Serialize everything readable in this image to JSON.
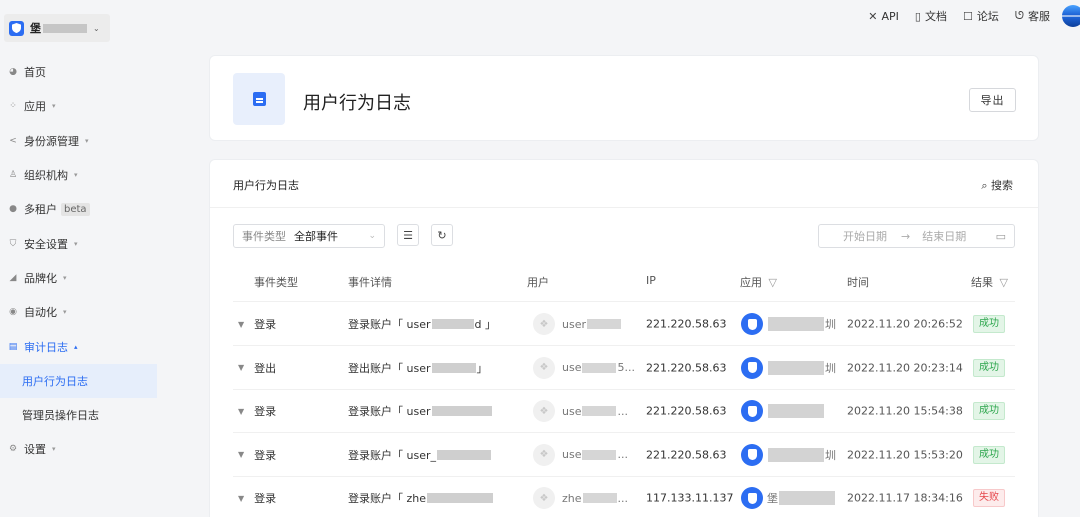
{
  "sidebar": {
    "brand_name": "堡",
    "items": [
      {
        "label": "首页",
        "icon": "pie-icon",
        "glyph": "◕",
        "caret": ""
      },
      {
        "label": "应用",
        "icon": "grid-icon",
        "glyph": "⁘",
        "caret": "▾"
      },
      {
        "label": "身份源管理",
        "icon": "share-icon",
        "glyph": "<",
        "caret": "▾"
      },
      {
        "label": "组织机构",
        "icon": "org-icon",
        "glyph": "♙",
        "caret": "▾"
      },
      {
        "label": "多租户",
        "icon": "tenant-icon",
        "glyph": "●",
        "caret": "",
        "badge": "beta"
      },
      {
        "label": "安全设置",
        "icon": "shield-icon",
        "glyph": "⛉",
        "caret": "▾"
      },
      {
        "label": "品牌化",
        "icon": "brand-icon",
        "glyph": "◢",
        "caret": "▾"
      },
      {
        "label": "自动化",
        "icon": "auto-icon",
        "glyph": "◉",
        "caret": "▾"
      },
      {
        "label": "审计日志",
        "icon": "audit-icon",
        "glyph": "▤",
        "caret": "▴"
      }
    ],
    "sub_items": [
      {
        "label": "用户行为日志"
      },
      {
        "label": "管理员操作日志"
      }
    ],
    "settings": {
      "label": "设置",
      "glyph": "⚙",
      "caret": "▾"
    }
  },
  "topbar": {
    "api": "API",
    "docs": "文档",
    "forum": "论坛",
    "support": "客服"
  },
  "header": {
    "title": "用户行为日志",
    "export_label": "导出"
  },
  "main": {
    "title": "用户行为日志",
    "search_label": "搜索",
    "filter_label": "事件类型",
    "filter_value": "全部事件",
    "date_start": "开始日期",
    "date_sep": "→",
    "date_end": "结束日期"
  },
  "table": {
    "columns": {
      "event_type": "事件类型",
      "detail": "事件详情",
      "user": "用户",
      "ip": "IP",
      "app": "应用",
      "time": "时间",
      "result": "结果"
    },
    "rows": [
      {
        "event": "登录",
        "detail_prefix": "登录账户「 user",
        "detail_suffix": "d 」",
        "user": "user",
        "ip": "221.220.58.63",
        "app_suffix": "圳",
        "time": "2022.11.20 20:26:52",
        "result": "成功",
        "ok": true
      },
      {
        "event": "登出",
        "detail_prefix": "登出账户「 user",
        "detail_suffix": "」",
        "user": "use",
        "user_suffix": "5...",
        "ip": "221.220.58.63",
        "app_suffix": "圳",
        "time": "2022.11.20 20:23:14",
        "result": "成功",
        "ok": true
      },
      {
        "event": "登录",
        "detail_prefix": "登录账户「 user",
        "detail_suffix": "",
        "user": "use",
        "user_suffix": "...",
        "ip": "221.220.58.63",
        "app_suffix": "",
        "time": "2022.11.20 15:54:38",
        "result": "成功",
        "ok": true
      },
      {
        "event": "登录",
        "detail_prefix": "登录账户「 user_",
        "detail_suffix": "",
        "user": "use",
        "user_suffix": "...",
        "ip": "221.220.58.63",
        "app_suffix": "圳",
        "time": "2022.11.20 15:53:20",
        "result": "成功",
        "ok": true
      },
      {
        "event": "登录",
        "detail_prefix": "登录账户「 zhe",
        "detail_suffix": "",
        "user": "zhe",
        "user_suffix": "...",
        "ip": "117.133.11.137",
        "app_prefix": "堡",
        "app_suffix": "",
        "time": "2022.11.17 18:34:16",
        "result": "失败",
        "ok": false
      }
    ]
  }
}
